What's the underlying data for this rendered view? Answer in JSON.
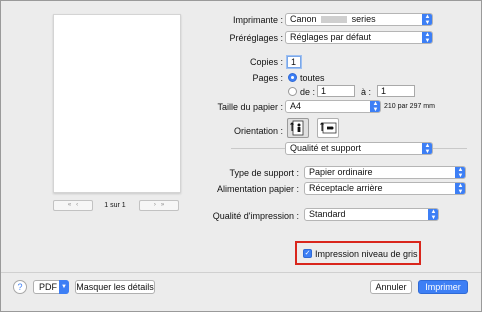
{
  "printer": {
    "label": "Imprimante :",
    "value_prefix": "Canon",
    "value_suffix": "series"
  },
  "presets": {
    "label": "Préréglages :",
    "value": "Réglages par défaut"
  },
  "copies": {
    "label": "Copies :",
    "value": "1"
  },
  "pages": {
    "label": "Pages :",
    "all_label": "toutes",
    "from_label": "de :",
    "from_value": "1",
    "to_label": "à :",
    "to_value": "1"
  },
  "paper_size": {
    "label": "Taille du papier :",
    "value": "A4",
    "dimensions": "210 par 297 mm"
  },
  "orientation": {
    "label": "Orientation :"
  },
  "section": {
    "value": "Qualité et support"
  },
  "media_type": {
    "label": "Type de support :",
    "value": "Papier ordinaire"
  },
  "paper_source": {
    "label": "Alimentation papier :",
    "value": "Réceptacle arrière"
  },
  "print_quality": {
    "label": "Qualité d'impression :",
    "value": "Standard"
  },
  "grayscale": {
    "label": "Impression niveau de gris",
    "checked": true
  },
  "preview_nav": {
    "page_indicator": "1 sur 1"
  },
  "footer": {
    "help": "?",
    "pdf": "PDF",
    "hide_details": "Masquer les détails",
    "cancel": "Annuler",
    "print": "Imprimer"
  },
  "colors": {
    "accent": "#3d7ff5",
    "highlight_border": "#d9261c"
  }
}
